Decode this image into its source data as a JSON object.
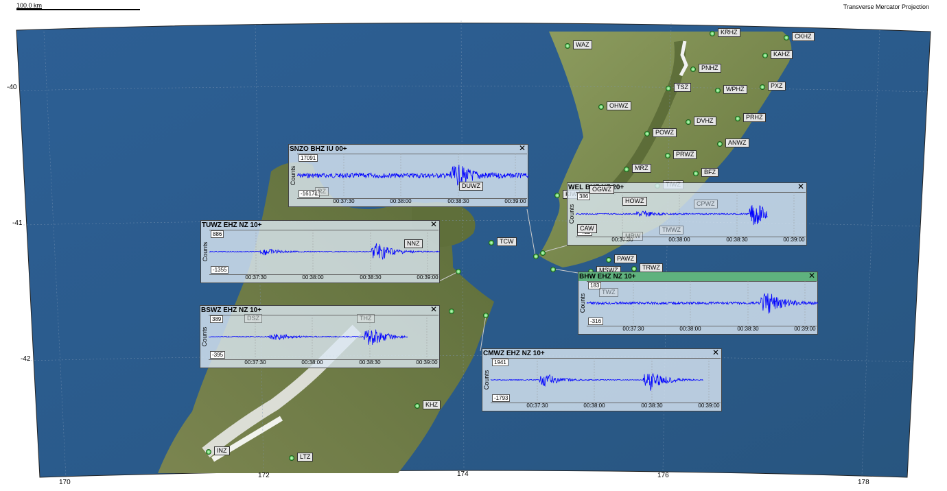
{
  "header": {
    "scale_label": "100.0 km",
    "projection": "Transverse Mercator Projection"
  },
  "axes": {
    "lat_labels": [
      "-40",
      "-41",
      "-42"
    ],
    "lon_labels": [
      "170",
      "172",
      "174",
      "176",
      "178"
    ]
  },
  "colors": {
    "ocean": "#2f5f8f",
    "land_north": "#86945a",
    "land_south": "#6c7a45",
    "trace": "#0000ff",
    "selected_header": "#5fb27e"
  },
  "stations": [
    {
      "code": "WAZ"
    },
    {
      "code": "KRHZ"
    },
    {
      "code": "CKHZ"
    },
    {
      "code": "KAHZ"
    },
    {
      "code": "PNHZ"
    },
    {
      "code": "TSZ"
    },
    {
      "code": "WPHZ"
    },
    {
      "code": "PXZ"
    },
    {
      "code": "OHWZ"
    },
    {
      "code": "DVHZ"
    },
    {
      "code": "PRHZ"
    },
    {
      "code": "POWZ"
    },
    {
      "code": "ANWZ"
    },
    {
      "code": "PRWZ"
    },
    {
      "code": "MRZ"
    },
    {
      "code": "BFZ"
    },
    {
      "code": "TIWZ"
    },
    {
      "code": "KIW"
    },
    {
      "code": "TCW"
    },
    {
      "code": "PAWZ"
    },
    {
      "code": "MSWZ"
    },
    {
      "code": "TRWZ"
    },
    {
      "code": "KHZ"
    },
    {
      "code": "INZ"
    },
    {
      "code": "LTZ"
    }
  ],
  "waveforms": [
    {
      "id": "snzo",
      "title": "SNZO BHZ IU 00+",
      "ylabel": "Counts",
      "ymax": "17091",
      "ymin": "-16174",
      "ticks": [
        "00:37:30",
        "00:38:00",
        "00:38:30",
        "00:39:00"
      ],
      "selected": false,
      "overlay_labels": [
        "DUWZ",
        "RZ"
      ]
    },
    {
      "id": "wel",
      "title": "WEL BHZ NZ 20+",
      "ylabel": "Counts",
      "ymax": "386",
      "ymin": "-432",
      "ticks": [
        "00:37:30",
        "00:38:00",
        "00:38:30",
        "00:39:00"
      ],
      "selected": false,
      "overlay_labels": [
        "OGWZ",
        "HOWZ",
        "CPWZ",
        "CAW",
        "TMWZ",
        "MRW"
      ]
    },
    {
      "id": "tuwz",
      "title": "TUWZ EHZ NZ 10+",
      "ylabel": "Counts",
      "ymax": "886",
      "ymin": "-1355",
      "ticks": [
        "00:37:30",
        "00:38:00",
        "00:38:30",
        "00:39:00"
      ],
      "selected": false,
      "overlay_labels": [
        "NNZ"
      ]
    },
    {
      "id": "bhw",
      "title": "BHW EHZ NZ 10+",
      "ylabel": "Counts",
      "ymax": "183",
      "ymin": "-316",
      "ticks": [
        "00:37:30",
        "00:38:00",
        "00:38:30",
        "00:39:00"
      ],
      "selected": true,
      "overlay_labels": [
        "TWZ"
      ]
    },
    {
      "id": "bswz",
      "title": "BSWZ EHZ NZ 10+",
      "ylabel": "Counts",
      "ymax": "389",
      "ymin": "-395",
      "ticks": [
        "00:37:30",
        "00:38:00",
        "00:38:30",
        "00:39:00"
      ],
      "selected": false,
      "overlay_labels": [
        "DSZ",
        "THZ"
      ]
    },
    {
      "id": "cmwz",
      "title": "CMWZ EHZ NZ 10+",
      "ylabel": "Counts",
      "ymax": "1941",
      "ymin": "-1793",
      "ticks": [
        "00:37:30",
        "00:38:00",
        "00:38:30",
        "00:39:00"
      ],
      "selected": false,
      "overlay_labels": []
    }
  ]
}
